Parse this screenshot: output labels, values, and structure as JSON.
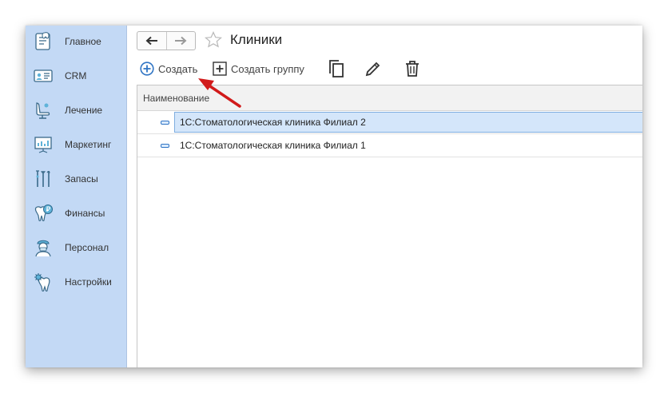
{
  "sidebar": {
    "items": [
      {
        "label": "Главное",
        "icon": "home-tooth-icon"
      },
      {
        "label": "CRM",
        "icon": "crm-card-icon"
      },
      {
        "label": "Лечение",
        "icon": "dental-chair-icon"
      },
      {
        "label": "Маркетинг",
        "icon": "presentation-icon"
      },
      {
        "label": "Запасы",
        "icon": "dental-tools-icon"
      },
      {
        "label": "Финансы",
        "icon": "tooth-ruble-icon"
      },
      {
        "label": "Персонал",
        "icon": "doctor-icon"
      },
      {
        "label": "Настройки",
        "icon": "tooth-gear-icon"
      }
    ]
  },
  "header": {
    "title": "Клиники"
  },
  "toolbar": {
    "create_label": "Создать",
    "create_group_label": "Создать группу"
  },
  "table": {
    "column_header": "Наименование",
    "rows": [
      {
        "name": "1С:Стоматологическая клиника Филиал 2",
        "selected": true
      },
      {
        "name": "1С:Стоматологическая клиника Филиал 1",
        "selected": false
      }
    ]
  },
  "colors": {
    "sidebar_bg": "#c3d9f5",
    "accent_blue": "#2f74c4",
    "selection_bg": "#d4e6fa",
    "annotation_arrow": "#d11a1a"
  }
}
